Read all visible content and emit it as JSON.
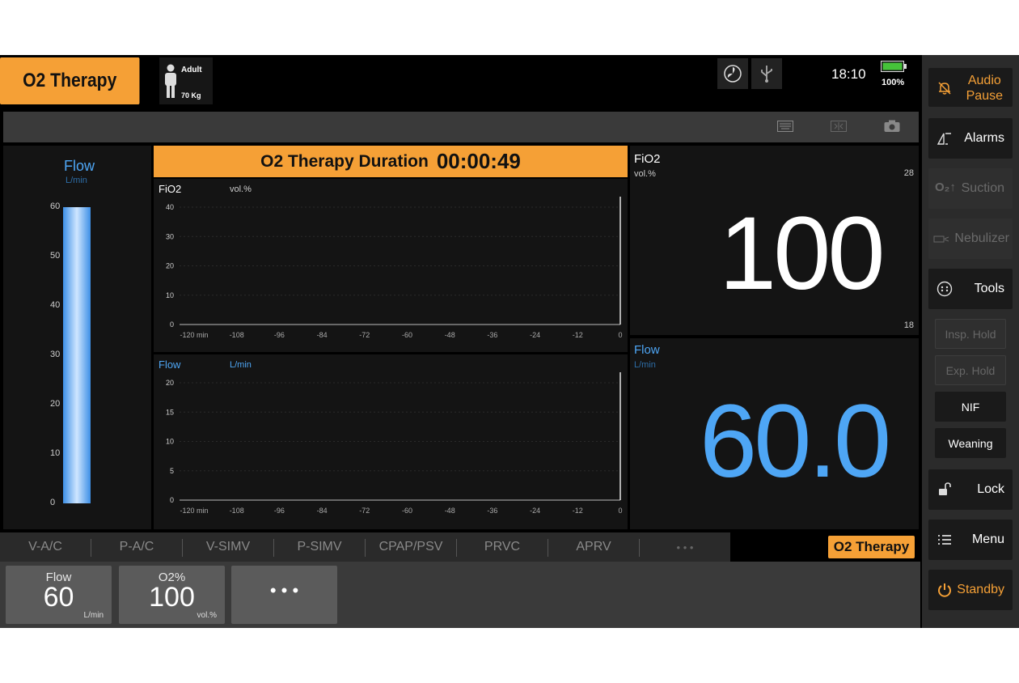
{
  "header": {
    "mode_title": "O2 Therapy",
    "patient_type": "Adult",
    "patient_weight": "70 Kg",
    "time": "18:10",
    "battery": "100%",
    "icons": [
      "fan-icon",
      "usb-icon",
      "battery-icon"
    ]
  },
  "toolbar": {
    "icons": [
      "keyboard-icon",
      "freeze-icon",
      "camera-icon"
    ]
  },
  "flow_bar": {
    "label": "Flow",
    "unit": "L/min",
    "scale": [
      "60",
      "50",
      "40",
      "30",
      "20",
      "10",
      "0"
    ],
    "max": 60,
    "value": 60
  },
  "duration": {
    "label": "O2 Therapy Duration",
    "value": "00:00:49"
  },
  "waveform_fio2": {
    "label": "FiO2",
    "unit": "vol.%",
    "y_ticks": [
      "40",
      "30",
      "20",
      "10",
      "0"
    ],
    "x_ticks": [
      "-120 min",
      "-108",
      "-96",
      "-84",
      "-72",
      "-60",
      "-48",
      "-36",
      "-24",
      "-12",
      "0"
    ]
  },
  "waveform_flow": {
    "label": "Flow",
    "unit": "L/min",
    "y_ticks": [
      "20",
      "15",
      "10",
      "5",
      "0"
    ],
    "x_ticks": [
      "-120 min",
      "-108",
      "-96",
      "-84",
      "-72",
      "-60",
      "-48",
      "-36",
      "-24",
      "-12",
      "0"
    ]
  },
  "fio2_monitor": {
    "label": "FiO2",
    "unit": "vol.%",
    "value": "100",
    "upper_limit": "28",
    "lower_limit": "18"
  },
  "flow_monitor": {
    "label": "Flow",
    "unit": "L/min",
    "value": "60.0"
  },
  "modes": {
    "tabs": [
      "V-A/C",
      "P-A/C",
      "V-SIMV",
      "P-SIMV",
      "CPAP/PSV",
      "PRVC",
      "APRV",
      "• • •"
    ],
    "active": "O2 Therapy"
  },
  "params": [
    {
      "name": "Flow",
      "value": "60",
      "unit": "L/min"
    },
    {
      "name": "O2%",
      "value": "100",
      "unit": "vol.%"
    },
    {
      "name": "",
      "value": "• • •",
      "unit": ""
    }
  ],
  "sidebar": {
    "audio_pause_line1": "Audio",
    "audio_pause_line2": "Pause",
    "alarms": "Alarms",
    "suction": "Suction",
    "nebulizer": "Nebulizer",
    "tools": "Tools",
    "insp_hold": "Insp. Hold",
    "exp_hold": "Exp. Hold",
    "nif": "NIF",
    "weaning": "Weaning",
    "lock": "Lock",
    "menu": "Menu",
    "standby": "Standby",
    "accent": "#f5a036"
  }
}
